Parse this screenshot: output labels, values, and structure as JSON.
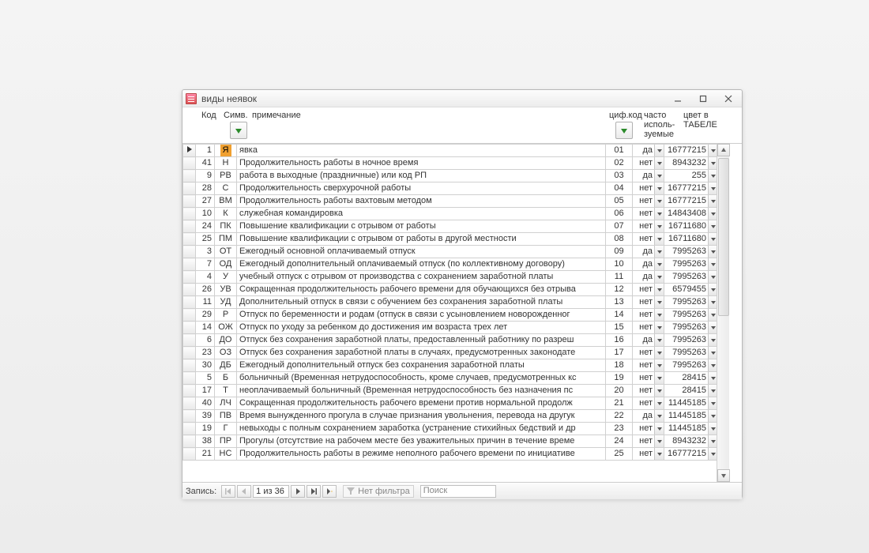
{
  "window": {
    "title": "виды неявок"
  },
  "headers": {
    "kod": "Код",
    "sym": "Симв.",
    "note": "примечание",
    "numcode": "циф.код",
    "freq1": "часто",
    "freq2": "исполь-",
    "freq3": "зуемые",
    "color1": "цвет в",
    "color2": "ТАБЕЛЕ"
  },
  "rows": [
    {
      "kod": "1",
      "sym": "Я",
      "desc": "явка",
      "num": "01",
      "freq": "да",
      "color": "16777215",
      "hl": true,
      "ptr": true
    },
    {
      "kod": "41",
      "sym": "Н",
      "desc": "Продолжительность работы в ночное время",
      "num": "02",
      "freq": "нет",
      "color": "8943232"
    },
    {
      "kod": "9",
      "sym": "РВ",
      "desc": "работа в выходные (праздничные) или код РП",
      "num": "03",
      "freq": "да",
      "color": "255"
    },
    {
      "kod": "28",
      "sym": "С",
      "desc": "Продолжительность сверхурочной работы",
      "num": "04",
      "freq": "нет",
      "color": "16777215"
    },
    {
      "kod": "27",
      "sym": "ВМ",
      "desc": "Продолжительность работы вахтовым методом",
      "num": "05",
      "freq": "нет",
      "color": "16777215"
    },
    {
      "kod": "10",
      "sym": "К",
      "desc": "служебная командировка",
      "num": "06",
      "freq": "нет",
      "color": "14843408"
    },
    {
      "kod": "24",
      "sym": "ПК",
      "desc": "Повышение квалификации с отрывом от работы",
      "num": "07",
      "freq": "нет",
      "color": "16711680"
    },
    {
      "kod": "25",
      "sym": "ПМ",
      "desc": "Повышение квалификации с отрывом от работы в другой местности",
      "num": "08",
      "freq": "нет",
      "color": "16711680"
    },
    {
      "kod": "3",
      "sym": "ОТ",
      "desc": "Ежегодный основной оплачиваемый отпуск",
      "num": "09",
      "freq": "да",
      "color": "7995263"
    },
    {
      "kod": "7",
      "sym": "ОД",
      "desc": "Ежегодный дополнительный оплачиваемый отпуск (по коллективному договору)",
      "num": "10",
      "freq": "да",
      "color": "7995263"
    },
    {
      "kod": "4",
      "sym": "У",
      "desc": "учебный отпуск с отрывом от производства с сохранением заработной платы",
      "num": "11",
      "freq": "да",
      "color": "7995263"
    },
    {
      "kod": "26",
      "sym": "УВ",
      "desc": "Сокращенная продолжительность рабочего времени для обучающихся без отрыва",
      "num": "12",
      "freq": "нет",
      "color": "6579455"
    },
    {
      "kod": "11",
      "sym": "УД",
      "desc": "Дополнительный отпуск в связи с обучением без сохранения заработной платы",
      "num": "13",
      "freq": "нет",
      "color": "7995263"
    },
    {
      "kod": "29",
      "sym": "Р",
      "desc": "Отпуск по беременности и родам (отпуск в связи с усыновлением новорожденног",
      "num": "14",
      "freq": "нет",
      "color": "7995263"
    },
    {
      "kod": "14",
      "sym": "ОЖ",
      "desc": "Отпуск по уходу за ребенком до достижения им возраста трех лет",
      "num": "15",
      "freq": "нет",
      "color": "7995263"
    },
    {
      "kod": "6",
      "sym": "ДО",
      "desc": "Отпуск без сохранения заработной платы, предоставленный работнику по разреш",
      "num": "16",
      "freq": "да",
      "color": "7995263"
    },
    {
      "kod": "23",
      "sym": "ОЗ",
      "desc": "Отпуск без сохранения заработной платы в случаях, предусмотренных законодате",
      "num": "17",
      "freq": "нет",
      "color": "7995263"
    },
    {
      "kod": "30",
      "sym": "ДБ",
      "desc": "Ежегодный дополнительный отпуск без сохранения заработной платы",
      "num": "18",
      "freq": "нет",
      "color": "7995263"
    },
    {
      "kod": "5",
      "sym": "Б",
      "desc": "больничный (Временная нетрудоспособность, кроме случаев, предусмотренных кс",
      "num": "19",
      "freq": "нет",
      "color": "28415"
    },
    {
      "kod": "17",
      "sym": "Т",
      "desc": "неоплачиваемый больничный (Временная нетрудоспособность без назначения пс",
      "num": "20",
      "freq": "нет",
      "color": "28415"
    },
    {
      "kod": "40",
      "sym": "ЛЧ",
      "desc": "Сокращенная продолжительность рабочего времени против нормальной продолж",
      "num": "21",
      "freq": "нет",
      "color": "11445185"
    },
    {
      "kod": "39",
      "sym": "ПВ",
      "desc": "Время вынужденного прогула в случае признания увольнения, перевода на другук",
      "num": "22",
      "freq": "да",
      "color": "11445185"
    },
    {
      "kod": "19",
      "sym": "Г",
      "desc": "невыходы с полным сохранением заработка (устранение стихийных бедствий и др",
      "num": "23",
      "freq": "нет",
      "color": "11445185"
    },
    {
      "kod": "38",
      "sym": "ПР",
      "desc": "Прогулы (отсутствие на рабочем месте без уважительных причин в течение време",
      "num": "24",
      "freq": "нет",
      "color": "8943232"
    },
    {
      "kod": "21",
      "sym": "НС",
      "desc": "Продолжительность работы в режиме неполного рабочего времени по инициативе",
      "num": "25",
      "freq": "нет",
      "color": "16777215"
    }
  ],
  "nav": {
    "label": "Запись:",
    "position": "1 из 36",
    "filter": "Нет фильтра",
    "search": "Поиск"
  }
}
